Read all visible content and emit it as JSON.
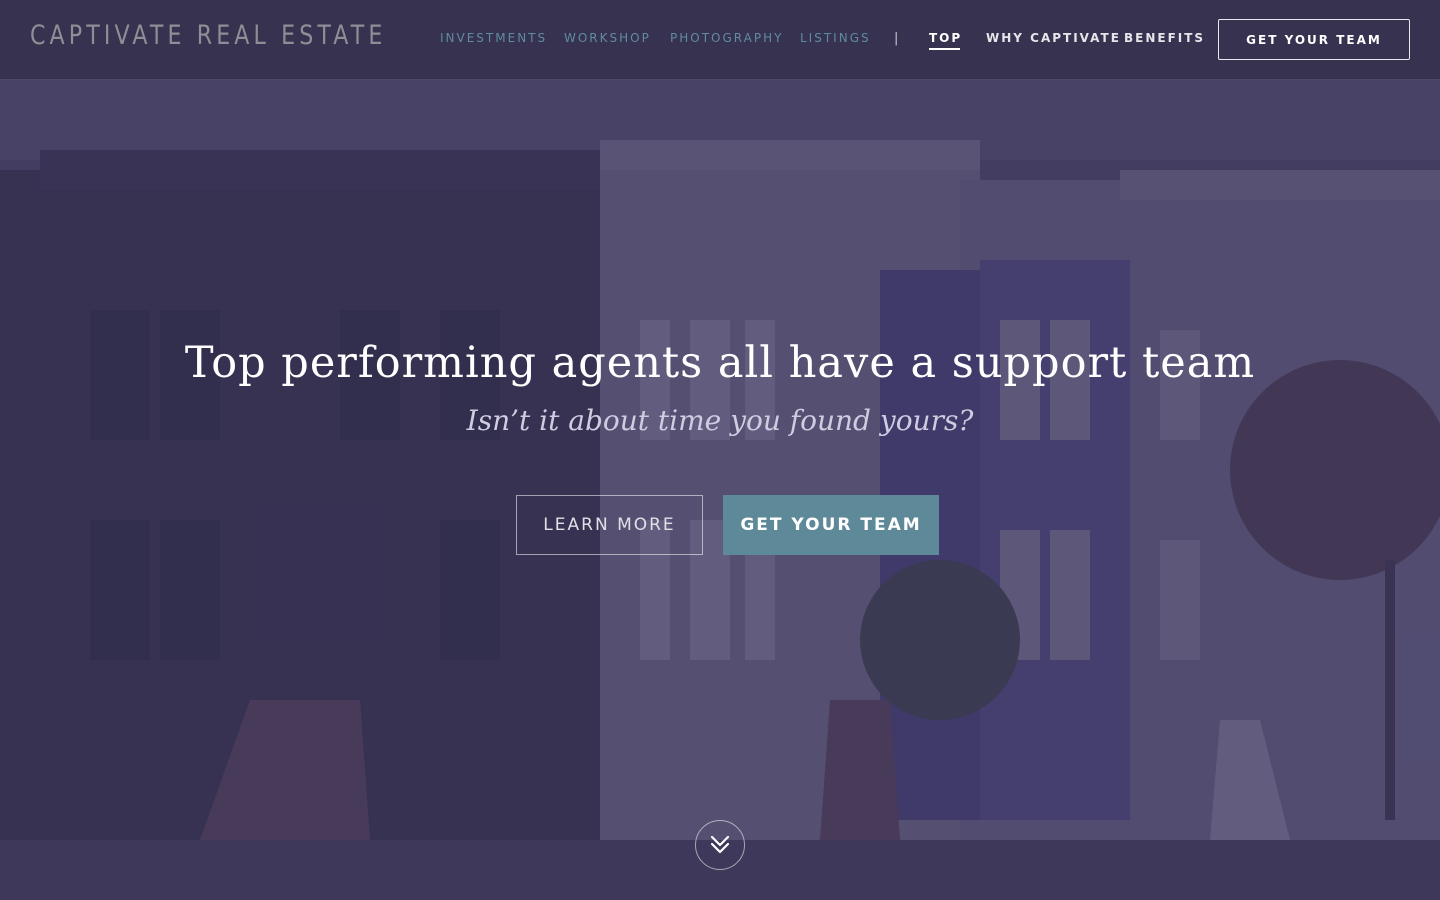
{
  "header": {
    "brand": "CAPTIVATE REAL ESTATE",
    "nav": [
      {
        "label": "INVESTMENTS"
      },
      {
        "label": "WORKSHOP"
      },
      {
        "label": "PHOTOGRAPHY"
      },
      {
        "label": "LISTINGS"
      },
      {
        "label": "TOP"
      },
      {
        "label": "WHY CAPTIVATE"
      },
      {
        "label": "BENEFITS"
      }
    ],
    "separator": "|",
    "cta_label": "GET YOUR TEAM"
  },
  "hero": {
    "headline": "Top performing agents all have a support team",
    "subhead": "Isn’t it about time you found yours?",
    "learn_more_label": "LEARN MORE",
    "get_team_label": "GET YOUR TEAM",
    "scroll_icon": "double-chevron-down-icon"
  },
  "colors": {
    "accent": "#5d8998",
    "nav_muted": "#5f8c9b",
    "overlay": "#3a345c",
    "text": "#ffffff"
  }
}
